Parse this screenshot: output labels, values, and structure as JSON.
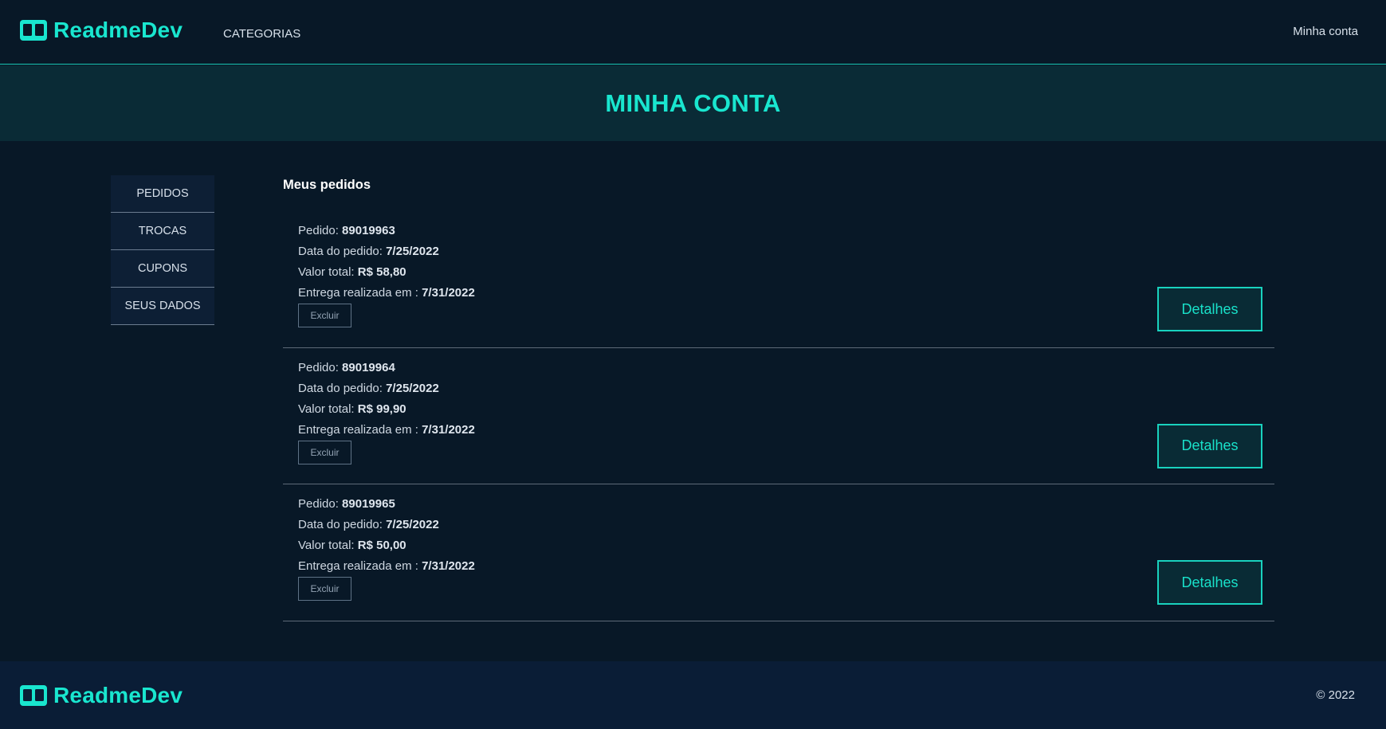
{
  "header": {
    "brand": "ReadmeDev",
    "nav_categories": "CATEGORIAS",
    "nav_account": "Minha conta"
  },
  "hero": {
    "title": "MINHA CONTA"
  },
  "sidebar": {
    "items": [
      {
        "label": "PEDIDOS"
      },
      {
        "label": "TROCAS"
      },
      {
        "label": "CUPONS"
      },
      {
        "label": "SEUS DADOS"
      }
    ]
  },
  "main": {
    "title": "Meus pedidos",
    "labels": {
      "order": "Pedido: ",
      "order_date": "Data do pedido: ",
      "total": "Valor total: ",
      "delivered": "Entrega realizada em : "
    },
    "delete_label": "Excluir",
    "details_label": "Detalhes",
    "orders": [
      {
        "number": "89019963",
        "date": "7/25/2022",
        "total": "R$ 58,80",
        "delivered": "7/31/2022"
      },
      {
        "number": "89019964",
        "date": "7/25/2022",
        "total": "R$ 99,90",
        "delivered": "7/31/2022"
      },
      {
        "number": "89019965",
        "date": "7/25/2022",
        "total": "R$ 50,00",
        "delivered": "7/31/2022"
      }
    ]
  },
  "footer": {
    "brand": "ReadmeDev",
    "copyright": "© 2022"
  },
  "colors": {
    "background": "#081827",
    "accent": "#19e6cf",
    "hero_bg": "#0a2b36",
    "footer_bg": "#0a1d36"
  },
  "icons": {
    "logo": "open-book-icon"
  }
}
